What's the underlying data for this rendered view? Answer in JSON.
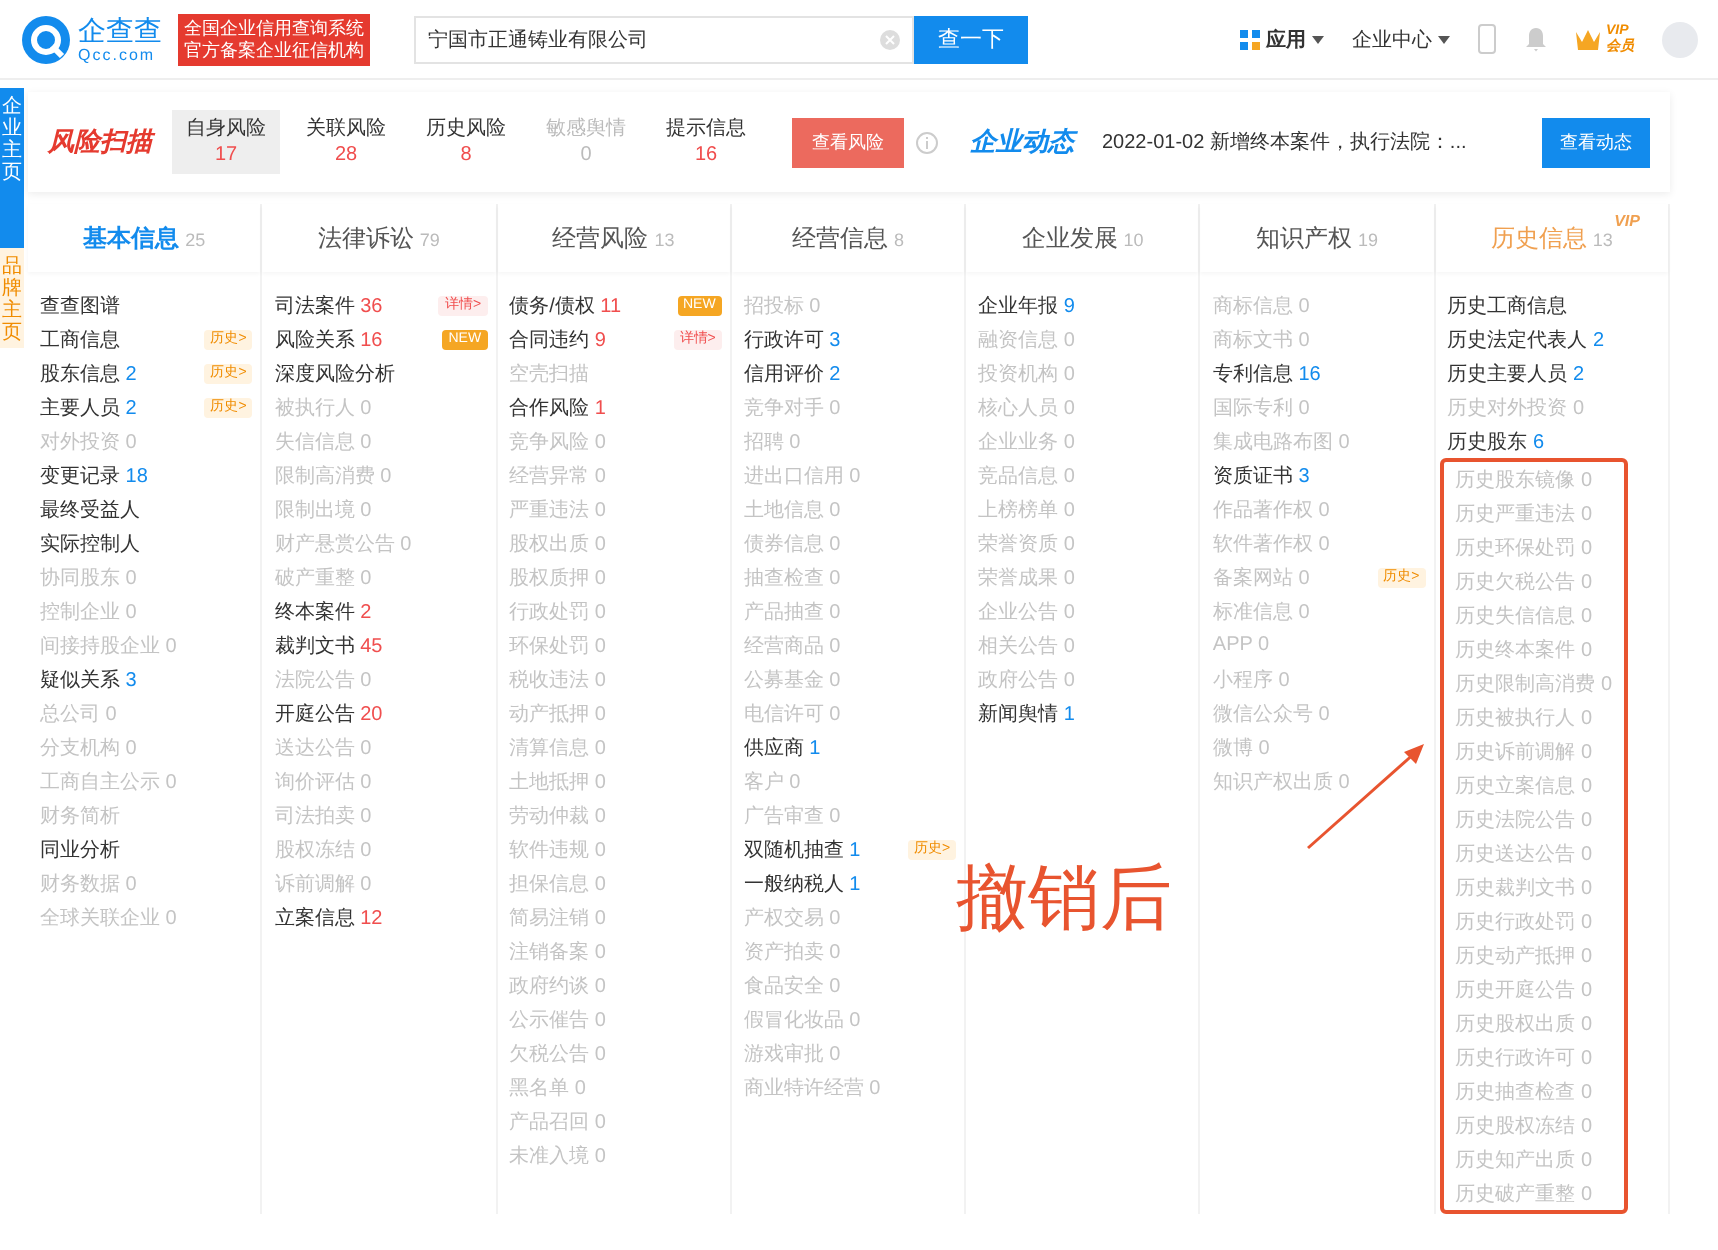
{
  "side_tabs": [
    {
      "label": "企业主页",
      "selected": true
    },
    {
      "label": "品牌主页",
      "selected": false
    }
  ],
  "header": {
    "logo": {
      "name": "企查查",
      "domain": "Qcc.com"
    },
    "slogan": [
      "全国企业信用查询系统",
      "官方备案企业征信机构"
    ],
    "search": {
      "value": "宁国市正通铸业有限公司",
      "button": "查一下"
    },
    "menus": [
      "应用",
      "企业中心"
    ],
    "vip": {
      "top": "VIP",
      "bottom": "会员"
    }
  },
  "risk_scan": {
    "title": "风险扫描",
    "tabs": [
      {
        "label": "自身风险",
        "count": "17",
        "selected": true,
        "disabled": false
      },
      {
        "label": "关联风险",
        "count": "28",
        "selected": false,
        "disabled": false
      },
      {
        "label": "历史风险",
        "count": "8",
        "selected": false,
        "disabled": false
      },
      {
        "label": "敏感舆情",
        "count": "0",
        "selected": false,
        "disabled": true
      },
      {
        "label": "提示信息",
        "count": "16",
        "selected": false,
        "disabled": false
      }
    ],
    "button": "查看风险",
    "news_title": "企业动态",
    "news": "2022-01-02 新增终本案件，执行法院：...",
    "news_button": "查看动态"
  },
  "columns": [
    {
      "title": "基本信息",
      "count": "25",
      "selected": true,
      "vip": false,
      "kind": "info",
      "items": [
        {
          "label": "查查图谱",
          "active": true
        },
        {
          "label": "工商信息",
          "active": true,
          "badge": {
            "kind": "history",
            "text": "历史>"
          }
        },
        {
          "label": "股东信息",
          "count": "2",
          "active": true,
          "badge": {
            "kind": "history",
            "text": "历史>"
          }
        },
        {
          "label": "主要人员",
          "count": "2",
          "active": true,
          "badge": {
            "kind": "history",
            "text": "历史>"
          }
        },
        {
          "label": "对外投资",
          "count": "0",
          "active": false
        },
        {
          "label": "变更记录",
          "count": "18",
          "active": true
        },
        {
          "label": "最终受益人",
          "active": true
        },
        {
          "label": "实际控制人",
          "active": true
        },
        {
          "label": "协同股东",
          "count": "0",
          "active": false
        },
        {
          "label": "控制企业",
          "count": "0",
          "active": false
        },
        {
          "label": "间接持股企业",
          "count": "0",
          "active": false
        },
        {
          "label": "疑似关系",
          "count": "3",
          "active": true
        },
        {
          "label": "总公司",
          "count": "0",
          "active": false
        },
        {
          "label": "分支机构",
          "count": "0",
          "active": false
        },
        {
          "label": "工商自主公示",
          "count": "0",
          "active": false
        },
        {
          "label": "财务简析",
          "active": false
        },
        {
          "label": "同业分析",
          "active": true
        },
        {
          "label": "财务数据",
          "count": "0",
          "active": false
        },
        {
          "label": "全球关联企业",
          "count": "0",
          "active": false
        }
      ]
    },
    {
      "title": "法律诉讼",
      "count": "79",
      "selected": false,
      "vip": false,
      "kind": "risk",
      "items": [
        {
          "label": "司法案件",
          "count": "36",
          "active": true,
          "badge": {
            "kind": "detail",
            "text": "详情>"
          }
        },
        {
          "label": "风险关系",
          "count": "16",
          "active": true,
          "badge": {
            "kind": "new",
            "text": "NEW"
          }
        },
        {
          "label": "深度风险分析",
          "active": true
        },
        {
          "label": "被执行人",
          "count": "0",
          "active": false
        },
        {
          "label": "失信信息",
          "count": "0",
          "active": false
        },
        {
          "label": "限制高消费",
          "count": "0",
          "active": false
        },
        {
          "label": "限制出境",
          "count": "0",
          "active": false
        },
        {
          "label": "财产悬赏公告",
          "count": "0",
          "active": false
        },
        {
          "label": "破产重整",
          "count": "0",
          "active": false
        },
        {
          "label": "终本案件",
          "count": "2",
          "active": true
        },
        {
          "label": "裁判文书",
          "count": "45",
          "active": true
        },
        {
          "label": "法院公告",
          "count": "0",
          "active": false
        },
        {
          "label": "开庭公告",
          "count": "20",
          "active": true
        },
        {
          "label": "送达公告",
          "count": "0",
          "active": false
        },
        {
          "label": "询价评估",
          "count": "0",
          "active": false
        },
        {
          "label": "司法拍卖",
          "count": "0",
          "active": false
        },
        {
          "label": "股权冻结",
          "count": "0",
          "active": false
        },
        {
          "label": "诉前调解",
          "count": "0",
          "active": false
        },
        {
          "label": "立案信息",
          "count": "12",
          "active": true
        }
      ]
    },
    {
      "title": "经营风险",
      "count": "13",
      "selected": false,
      "vip": false,
      "kind": "risk",
      "items": [
        {
          "label": "债务/债权",
          "count": "11",
          "active": true,
          "badge": {
            "kind": "new",
            "text": "NEW"
          }
        },
        {
          "label": "合同违约",
          "count": "9",
          "active": true,
          "badge": {
            "kind": "detail",
            "text": "详情>"
          }
        },
        {
          "label": "空壳扫描",
          "active": false
        },
        {
          "label": "合作风险",
          "count": "1",
          "active": true
        },
        {
          "label": "竞争风险",
          "count": "0",
          "active": false
        },
        {
          "label": "经营异常",
          "count": "0",
          "active": false
        },
        {
          "label": "严重违法",
          "count": "0",
          "active": false
        },
        {
          "label": "股权出质",
          "count": "0",
          "active": false
        },
        {
          "label": "股权质押",
          "count": "0",
          "active": false
        },
        {
          "label": "行政处罚",
          "count": "0",
          "active": false
        },
        {
          "label": "环保处罚",
          "count": "0",
          "active": false
        },
        {
          "label": "税收违法",
          "count": "0",
          "active": false
        },
        {
          "label": "动产抵押",
          "count": "0",
          "active": false
        },
        {
          "label": "清算信息",
          "count": "0",
          "active": false
        },
        {
          "label": "土地抵押",
          "count": "0",
          "active": false
        },
        {
          "label": "劳动仲裁",
          "count": "0",
          "active": false
        },
        {
          "label": "软件违规",
          "count": "0",
          "active": false
        },
        {
          "label": "担保信息",
          "count": "0",
          "active": false
        },
        {
          "label": "简易注销",
          "count": "0",
          "active": false
        },
        {
          "label": "注销备案",
          "count": "0",
          "active": false
        },
        {
          "label": "政府约谈",
          "count": "0",
          "active": false
        },
        {
          "label": "公示催告",
          "count": "0",
          "active": false
        },
        {
          "label": "欠税公告",
          "count": "0",
          "active": false
        },
        {
          "label": "黑名单",
          "count": "0",
          "active": false
        },
        {
          "label": "产品召回",
          "count": "0",
          "active": false
        },
        {
          "label": "未准入境",
          "count": "0",
          "active": false
        }
      ]
    },
    {
      "title": "经营信息",
      "count": "8",
      "selected": false,
      "vip": false,
      "kind": "info",
      "items": [
        {
          "label": "招投标",
          "count": "0",
          "active": false
        },
        {
          "label": "行政许可",
          "count": "3",
          "active": true
        },
        {
          "label": "信用评价",
          "count": "2",
          "active": true
        },
        {
          "label": "竞争对手",
          "count": "0",
          "active": false
        },
        {
          "label": "招聘",
          "count": "0",
          "active": false
        },
        {
          "label": "进出口信用",
          "count": "0",
          "active": false
        },
        {
          "label": "土地信息",
          "count": "0",
          "active": false
        },
        {
          "label": "债券信息",
          "count": "0",
          "active": false
        },
        {
          "label": "抽查检查",
          "count": "0",
          "active": false
        },
        {
          "label": "产品抽查",
          "count": "0",
          "active": false
        },
        {
          "label": "经营商品",
          "count": "0",
          "active": false
        },
        {
          "label": "公募基金",
          "count": "0",
          "active": false
        },
        {
          "label": "电信许可",
          "count": "0",
          "active": false
        },
        {
          "label": "供应商",
          "count": "1",
          "active": true
        },
        {
          "label": "客户",
          "count": "0",
          "active": false
        },
        {
          "label": "广告审查",
          "count": "0",
          "active": false
        },
        {
          "label": "双随机抽查",
          "count": "1",
          "active": true,
          "badge": {
            "kind": "history",
            "text": "历史>"
          }
        },
        {
          "label": "一般纳税人",
          "count": "1",
          "active": true
        },
        {
          "label": "产权交易",
          "count": "0",
          "active": false
        },
        {
          "label": "资产拍卖",
          "count": "0",
          "active": false
        },
        {
          "label": "食品安全",
          "count": "0",
          "active": false
        },
        {
          "label": "假冒化妆品",
          "count": "0",
          "active": false
        },
        {
          "label": "游戏审批",
          "count": "0",
          "active": false
        },
        {
          "label": "商业特许经营",
          "count": "0",
          "active": false
        }
      ]
    },
    {
      "title": "企业发展",
      "count": "10",
      "selected": false,
      "vip": false,
      "kind": "info",
      "items": [
        {
          "label": "企业年报",
          "count": "9",
          "active": true
        },
        {
          "label": "融资信息",
          "count": "0",
          "active": false
        },
        {
          "label": "投资机构",
          "count": "0",
          "active": false
        },
        {
          "label": "核心人员",
          "count": "0",
          "active": false
        },
        {
          "label": "企业业务",
          "count": "0",
          "active": false
        },
        {
          "label": "竞品信息",
          "count": "0",
          "active": false
        },
        {
          "label": "上榜榜单",
          "count": "0",
          "active": false
        },
        {
          "label": "荣誉资质",
          "count": "0",
          "active": false
        },
        {
          "label": "荣誉成果",
          "count": "0",
          "active": false
        },
        {
          "label": "企业公告",
          "count": "0",
          "active": false
        },
        {
          "label": "相关公告",
          "count": "0",
          "active": false
        },
        {
          "label": "政府公告",
          "count": "0",
          "active": false
        },
        {
          "label": "新闻舆情",
          "count": "1",
          "active": true
        }
      ]
    },
    {
      "title": "知识产权",
      "count": "19",
      "selected": false,
      "vip": false,
      "kind": "info",
      "items": [
        {
          "label": "商标信息",
          "count": "0",
          "active": false
        },
        {
          "label": "商标文书",
          "count": "0",
          "active": false
        },
        {
          "label": "专利信息",
          "count": "16",
          "active": true
        },
        {
          "label": "国际专利",
          "count": "0",
          "active": false
        },
        {
          "label": "集成电路布图",
          "count": "0",
          "active": false
        },
        {
          "label": "资质证书",
          "count": "3",
          "active": true
        },
        {
          "label": "作品著作权",
          "count": "0",
          "active": false
        },
        {
          "label": "软件著作权",
          "count": "0",
          "active": false
        },
        {
          "label": "备案网站",
          "count": "0",
          "active": false,
          "badge": {
            "kind": "history",
            "text": "历史>"
          }
        },
        {
          "label": "标准信息",
          "count": "0",
          "active": false
        },
        {
          "label": "APP",
          "count": "0",
          "active": false
        },
        {
          "label": "小程序",
          "count": "0",
          "active": false
        },
        {
          "label": "微信公众号",
          "count": "0",
          "active": false
        },
        {
          "label": "微博",
          "count": "0",
          "active": false
        },
        {
          "label": "知识产权出质",
          "count": "0",
          "active": false
        }
      ]
    },
    {
      "title": "历史信息",
      "count": "13",
      "selected": false,
      "vip": true,
      "vip_text": "VIP",
      "kind": "info",
      "items": [
        {
          "label": "历史工商信息",
          "active": true
        },
        {
          "label": "历史法定代表人",
          "count": "2",
          "active": true
        },
        {
          "label": "历史主要人员",
          "count": "2",
          "active": true
        },
        {
          "label": "历史对外投资",
          "count": "0",
          "active": false
        },
        {
          "label": "历史股东",
          "count": "6",
          "active": true
        }
      ],
      "boxed_items": [
        {
          "label": "历史股东镜像",
          "count": "0",
          "active": false
        },
        {
          "label": "历史严重违法",
          "count": "0",
          "active": false
        },
        {
          "label": "历史环保处罚",
          "count": "0",
          "active": false
        },
        {
          "label": "历史欠税公告",
          "count": "0",
          "active": false
        },
        {
          "label": "历史失信信息",
          "count": "0",
          "active": false
        },
        {
          "label": "历史终本案件",
          "count": "0",
          "active": false
        },
        {
          "label": "历史限制高消费",
          "count": "0",
          "active": false
        },
        {
          "label": "历史被执行人",
          "count": "0",
          "active": false
        },
        {
          "label": "历史诉前调解",
          "count": "0",
          "active": false
        },
        {
          "label": "历史立案信息",
          "count": "0",
          "active": false
        },
        {
          "label": "历史法院公告",
          "count": "0",
          "active": false
        },
        {
          "label": "历史送达公告",
          "count": "0",
          "active": false
        },
        {
          "label": "历史裁判文书",
          "count": "0",
          "active": false
        },
        {
          "label": "历史行政处罚",
          "count": "0",
          "active": false
        },
        {
          "label": "历史动产抵押",
          "count": "0",
          "active": false
        },
        {
          "label": "历史开庭公告",
          "count": "0",
          "active": false
        },
        {
          "label": "历史股权出质",
          "count": "0",
          "active": false
        },
        {
          "label": "历史行政许可",
          "count": "0",
          "active": false
        },
        {
          "label": "历史抽查检查",
          "count": "0",
          "active": false
        },
        {
          "label": "历史股权冻结",
          "count": "0",
          "active": false
        },
        {
          "label": "历史知产出质",
          "count": "0",
          "active": false
        },
        {
          "label": "历史破产重整",
          "count": "0",
          "active": false
        }
      ]
    }
  ],
  "annotation": {
    "text": "撤销后"
  }
}
